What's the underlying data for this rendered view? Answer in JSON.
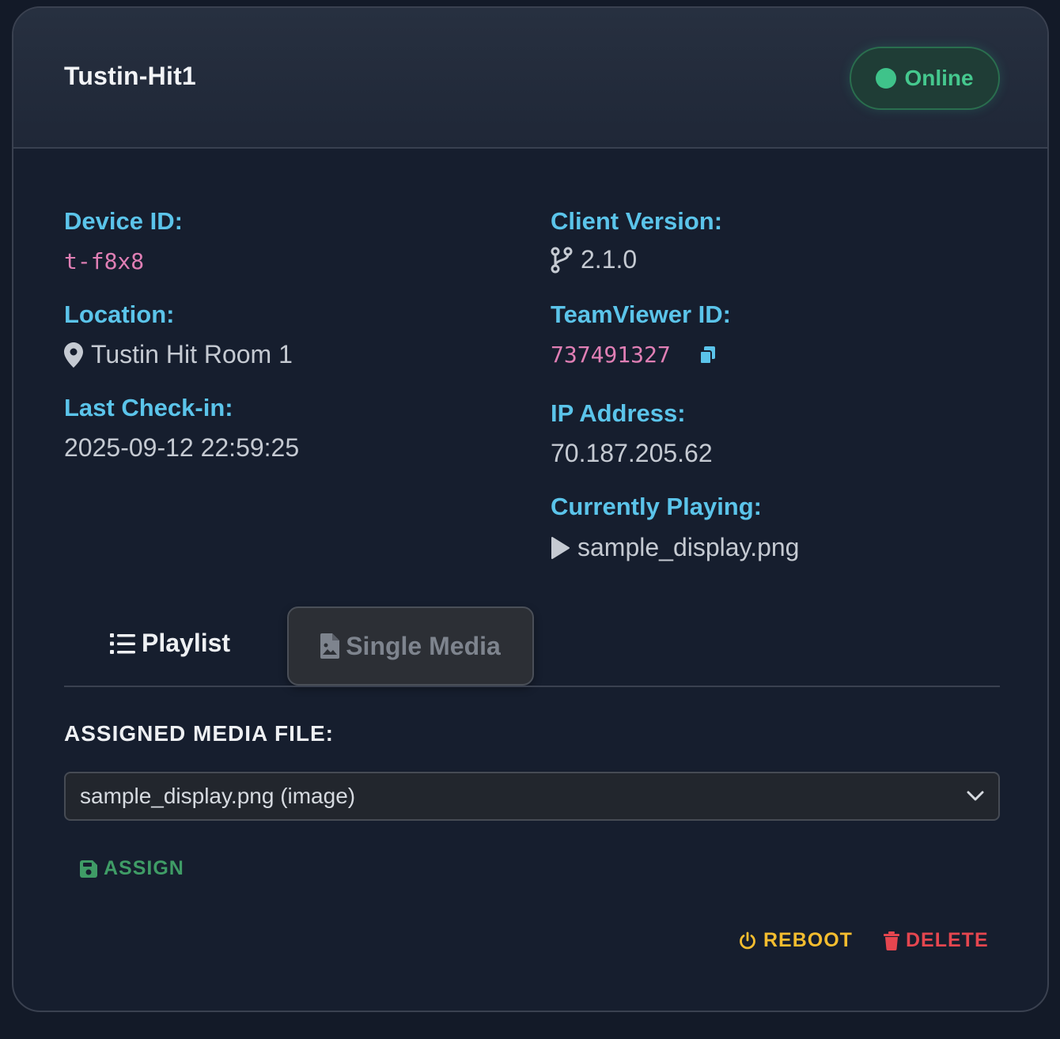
{
  "device": {
    "name": "Tustin-Hit1",
    "status": "Online",
    "status_color": "#3fc38a"
  },
  "details": {
    "device_id_label": "Device ID:",
    "device_id": "t-f8x8",
    "location_label": "Location:",
    "location": "Tustin Hit Room 1",
    "last_checkin_label": "Last Check-in:",
    "last_checkin": "2025-09-12 22:59:25",
    "client_version_label": "Client Version:",
    "client_version": "2.1.0",
    "teamviewer_label": "TeamViewer ID:",
    "teamviewer_id": "737491327",
    "ip_label": "IP Address:",
    "ip": "70.187.205.62",
    "playing_label": "Currently Playing:",
    "playing": "sample_display.png"
  },
  "tabs": [
    {
      "label": "Playlist",
      "icon": "list-icon"
    },
    {
      "label": "Single Media",
      "icon": "file-image-icon",
      "selected": true
    }
  ],
  "media": {
    "assigned_label": "ASSIGNED MEDIA FILE:",
    "selected_file": "sample_display.png (image)"
  },
  "actions": {
    "assign": "ASSIGN",
    "reboot": "REBOOT",
    "delete": "DELETE"
  },
  "colors": {
    "accent_label": "#5bc4ea",
    "mono_value": "#e07fb5",
    "assign": "#3f9c66",
    "reboot": "#f4bd2f",
    "delete": "#e5464f"
  }
}
